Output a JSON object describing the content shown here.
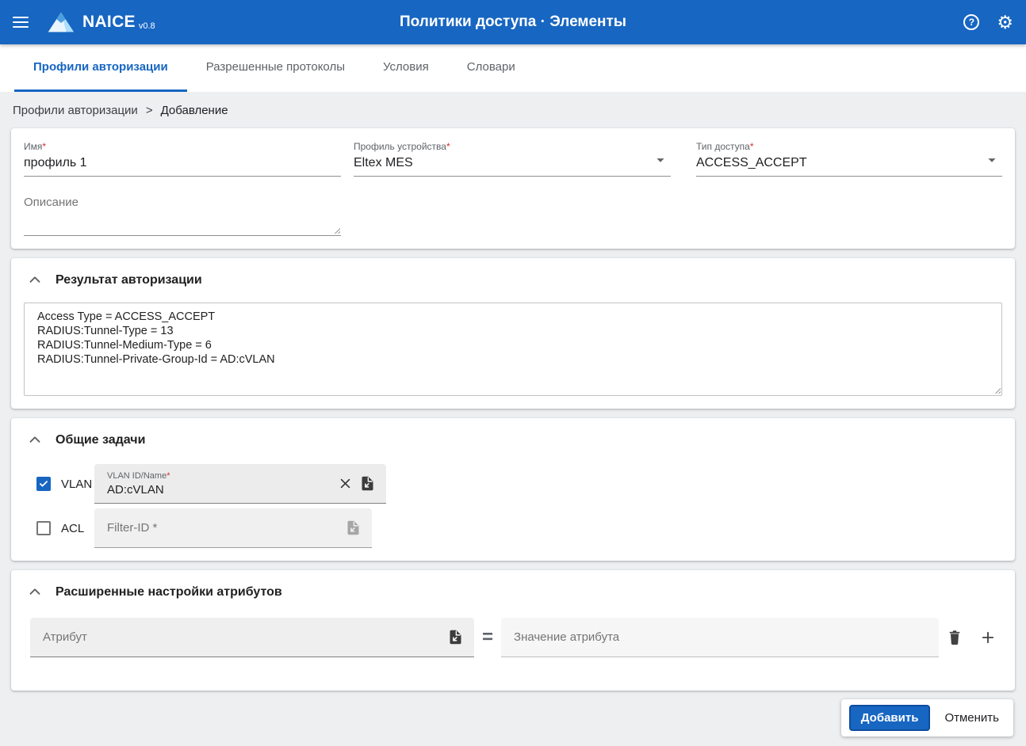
{
  "appbar": {
    "brand": "NAICE",
    "version": "v0.8",
    "title": "Политики доступа · Элементы",
    "help_glyph": "?",
    "gear_glyph": "⚙"
  },
  "tabs": [
    {
      "label": "Профили авторизации",
      "active": true
    },
    {
      "label": "Разрешенные протоколы",
      "active": false
    },
    {
      "label": "Условия",
      "active": false
    },
    {
      "label": "Словари",
      "active": false
    }
  ],
  "breadcrumb": {
    "root": "Профили авторизации",
    "separator": ">",
    "current": "Добавление"
  },
  "form": {
    "name": {
      "label": "Имя",
      "required": "*",
      "value": "профиль 1"
    },
    "device_profile": {
      "label": "Профиль устройства",
      "required": "*",
      "value": "Eltex MES"
    },
    "access_type": {
      "label": "Тип доступа",
      "required": "*",
      "value": "ACCESS_ACCEPT"
    },
    "description": {
      "placeholder": "Описание"
    }
  },
  "auth_result": {
    "title": "Результат авторизации",
    "value": "Access Type = ACCESS_ACCEPT\nRADIUS:Tunnel-Type = 13\nRADIUS:Tunnel-Medium-Type = 6\nRADIUS:Tunnel-Private-Group-Id = AD:cVLAN"
  },
  "common_tasks": {
    "title": "Общие задачи",
    "vlan": {
      "checkbox_label": "VLAN",
      "checked": true,
      "field_label": "VLAN ID/Name",
      "required": "*",
      "value": "AD:cVLAN"
    },
    "acl": {
      "checkbox_label": "ACL",
      "checked": false,
      "placeholder": "Filter-ID *"
    }
  },
  "advanced": {
    "title": "Расширенные настройки атрибутов",
    "attribute_placeholder": "Атрибут",
    "equals_sign": "=",
    "value_placeholder": "Значение атрибута"
  },
  "actions": {
    "submit": "Добавить",
    "cancel": "Отменить"
  },
  "colors": {
    "primary": "#1766c2",
    "required_asterisk": "#d32f2f"
  }
}
